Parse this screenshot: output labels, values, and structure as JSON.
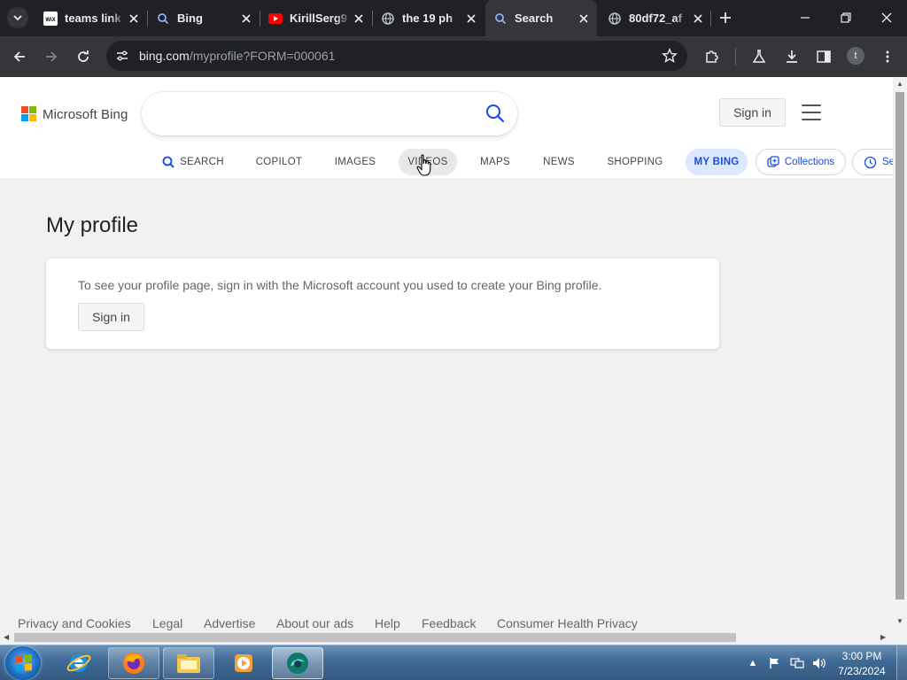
{
  "browser": {
    "tabs": [
      {
        "title": "teams link",
        "favicon": "wix-icon"
      },
      {
        "title": "Bing",
        "favicon": "bing-search-icon"
      },
      {
        "title": "KirillSerg9",
        "favicon": "youtube-icon"
      },
      {
        "title": "the 19 ph",
        "favicon": "globe-icon"
      },
      {
        "title": "Search",
        "favicon": "bing-search-icon",
        "active": true
      },
      {
        "title": "80df72_af",
        "favicon": "globe-icon"
      }
    ],
    "url_host": "bing.com",
    "url_path": "/myprofile?FORM=000061",
    "profile_initial": "t"
  },
  "bing": {
    "logo_text": "Microsoft Bing",
    "search_placeholder": "",
    "signin_label": "Sign in",
    "scopes": {
      "search": "SEARCH",
      "copilot": "COPILOT",
      "images": "IMAGES",
      "videos": "VIDEOS",
      "maps": "MAPS",
      "news": "NEWS",
      "shopping": "SHOPPING",
      "mybing": "MY BING",
      "collections": "Collections",
      "history": "Se"
    }
  },
  "profile": {
    "title": "My profile",
    "message": "To see your profile page, sign in with the Microsoft account you used to create your Bing profile.",
    "signin_label": "Sign in"
  },
  "footer": {
    "links": [
      "Privacy and Cookies",
      "Legal",
      "Advertise",
      "About our ads",
      "Help",
      "Feedback",
      "Consumer Health Privacy"
    ]
  },
  "taskbar": {
    "time": "3:00 PM",
    "date": "7/23/2024",
    "apps": [
      "internet-explorer-icon",
      "firefox-icon",
      "file-explorer-icon",
      "media-player-icon",
      "browser-app-icon"
    ]
  },
  "colors": {
    "bing_blue": "#174ae4",
    "chrome_dark": "#202124",
    "chrome_toolbar": "#35363a"
  }
}
